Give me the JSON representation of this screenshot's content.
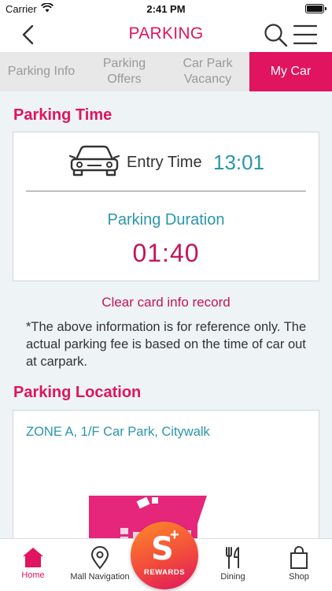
{
  "status_bar": {
    "carrier": "Carrier",
    "time": "2:41 PM"
  },
  "nav": {
    "title": "PARKING"
  },
  "tabs": [
    {
      "label": "Parking Info",
      "active": false
    },
    {
      "label": "Parking Offers",
      "active": false
    },
    {
      "label": "Car Park Vacancy",
      "active": false
    },
    {
      "label": "My Car",
      "active": true
    }
  ],
  "parking_time": {
    "title": "Parking Time",
    "entry_label": "Entry Time",
    "entry_value": "13:01",
    "duration_label": "Parking Duration",
    "duration_value": "01:40"
  },
  "clear_link": "Clear card info record",
  "disclaimer": "*The above information is for reference only. The actual parking fee is based on the time of car out at carpark.",
  "parking_location": {
    "title": "Parking Location",
    "zone": "ZONE A, 1/F Car Park, Citywalk"
  },
  "bottom_nav": {
    "home": "Home",
    "mall_navigation": "Mall Navigation",
    "rewards": "REWARDS",
    "dining": "Dining",
    "shop": "Shop"
  },
  "colors": {
    "brand": "#e0145f",
    "accent_teal": "#2a96ad",
    "tab_inactive_bg": "#e8e8e8"
  }
}
